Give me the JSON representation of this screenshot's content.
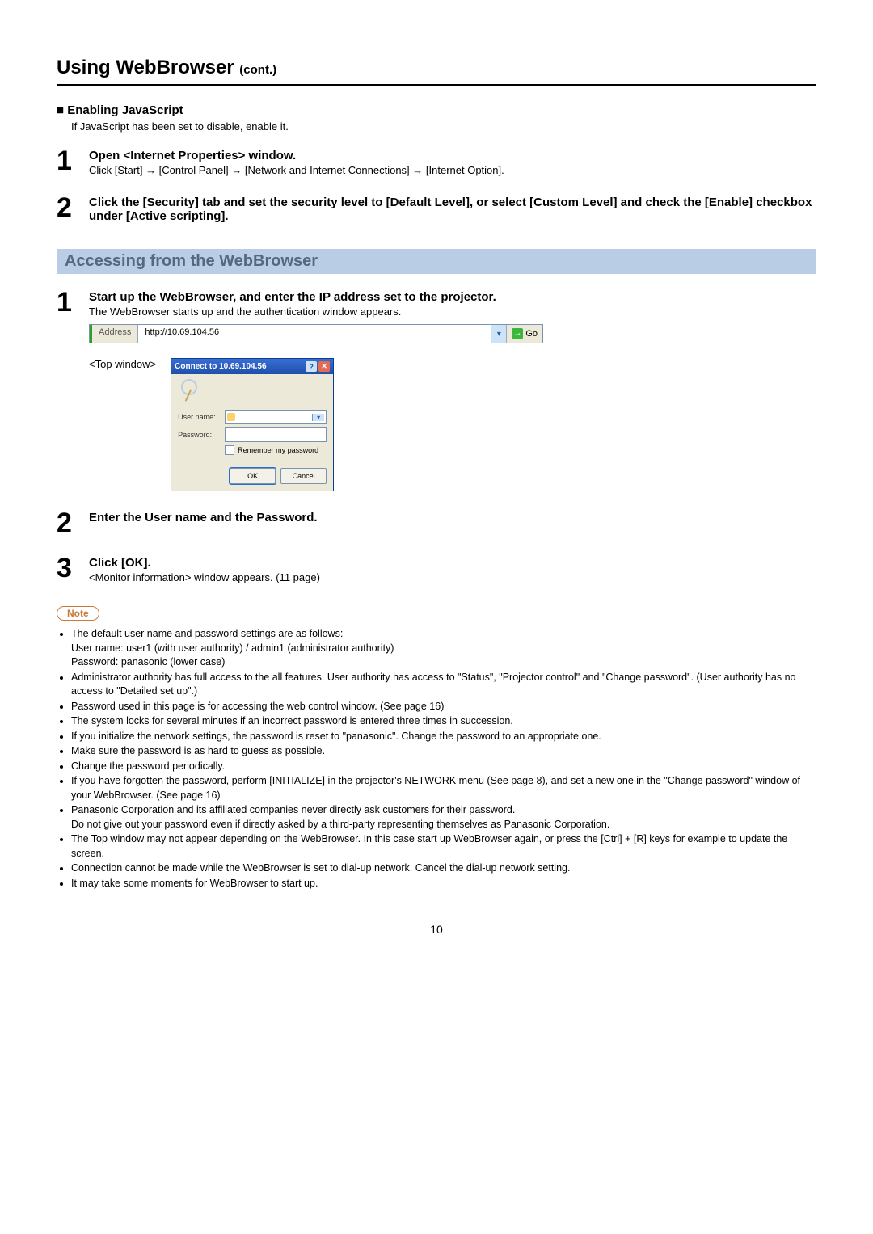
{
  "title": {
    "main": "Using WebBrowser",
    "cont": "(cont.)"
  },
  "enable_js": {
    "heading": "Enabling JavaScript",
    "desc": "If JavaScript has been set to disable, enable it."
  },
  "enable_steps": [
    {
      "num": "1",
      "title": "Open <Internet Properties> window.",
      "sub": "Click [Start] → [Control Panel] → [Network and Internet Connections] → [Internet Option]."
    },
    {
      "num": "2",
      "title": "Click the [Security] tab and set the security level to [Default Level], or select [Custom Level] and check the [Enable] checkbox under [Active scripting].",
      "sub": ""
    }
  ],
  "access_banner": "Accessing from the WebBrowser",
  "access_steps": [
    {
      "num": "1",
      "title": "Start up the WebBrowser, and enter the IP address set to the projector.",
      "sub": "The WebBrowser starts up and the authentication window appears."
    },
    {
      "num": "2",
      "title": "Enter the User name and the Password.",
      "sub": ""
    },
    {
      "num": "3",
      "title": "Click [OK].",
      "sub": "<Monitor information> window appears. (11 page)"
    }
  ],
  "address_bar": {
    "label": "Address",
    "url": "http://10.69.104.56",
    "go": "Go"
  },
  "top_window_label": "<Top window>",
  "dialog": {
    "title": "Connect to 10.69.104.56",
    "user_label": "User name:",
    "pass_label": "Password:",
    "remember": "Remember my password",
    "ok": "OK",
    "cancel": "Cancel"
  },
  "note_label": "Note",
  "notes": [
    "The default user name and password settings are as follows:\nUser name: user1 (with user authority) / admin1 (administrator authority)\nPassword: panasonic (lower case)",
    "Administrator authority has full access to the all features. User authority has access to \"Status\", \"Projector control\" and \"Change password\". (User authority has no access to \"Detailed set up\".)",
    "Password used in this page is for accessing the web control window. (See page 16)",
    "The system locks for several minutes if an incorrect password is entered three times in succession.",
    "If you initialize the network settings, the password is reset to \"panasonic\". Change the password to an appropriate one.",
    "Make sure the password is as hard to guess as possible.",
    "Change the password periodically.",
    "If you have forgotten the password, perform [INITIALIZE] in the projector's NETWORK menu (See page 8), and set a new one in the \"Change password\" window of your WebBrowser. (See page 16)",
    "Panasonic Corporation and its affiliated companies never directly ask customers for their password.\nDo not give out your password even if directly asked by a third-party representing themselves as Panasonic Corporation.",
    "The Top window may not appear depending on the WebBrowser. In this case start up WebBrowser again, or press the [Ctrl] + [R] keys for example to update the screen.",
    "Connection cannot be made while the WebBrowser is set to dial-up network. Cancel the dial-up network setting.",
    "It may take some moments for WebBrowser to start up."
  ],
  "page_number": "10"
}
